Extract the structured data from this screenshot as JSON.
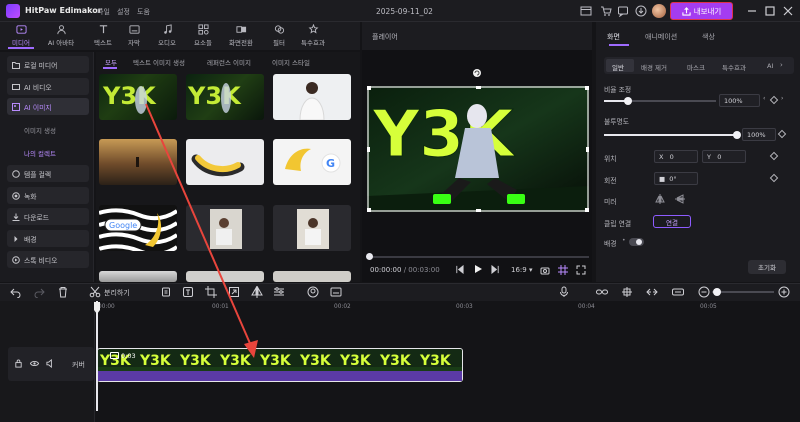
{
  "titlebar": {
    "app_name": "HitPaw Edimakor",
    "menus": [
      "파일",
      "설정",
      "도움"
    ],
    "project_title": "2025-09-11_02",
    "export_label": "내보내기"
  },
  "media_tabs": [
    {
      "label": "미디어",
      "icon": "media-icon"
    },
    {
      "label": "AI 아바타",
      "icon": "ai-avatar-icon"
    },
    {
      "label": "텍스트",
      "icon": "text-icon"
    },
    {
      "label": "자막",
      "icon": "subtitle-icon"
    },
    {
      "label": "오디오",
      "icon": "audio-icon"
    },
    {
      "label": "요소들",
      "icon": "elements-icon"
    },
    {
      "label": "화면전환",
      "icon": "transition-icon"
    },
    {
      "label": "필터",
      "icon": "filter-icon"
    },
    {
      "label": "특수효과",
      "icon": "effects-icon"
    }
  ],
  "left_nav": {
    "items": [
      "로컬 미디어",
      "AI 비디오",
      "AI 이미지",
      "템플 컬렉",
      "녹화",
      "다운로드",
      "배경",
      "스톡 비디오"
    ],
    "sub_items": [
      "이미지 생성",
      "나의 컬렉트"
    ]
  },
  "filter_tabs": [
    "모두",
    "텍스트 이미지 생성",
    "레퍼런스 이미지",
    "이미지 스타일"
  ],
  "thumbs": [
    {
      "text": "Y3K"
    },
    {
      "text": "Y3K"
    },
    {
      "text": ""
    },
    {
      "text": ""
    },
    {
      "text": ""
    },
    {
      "text": "G"
    },
    {
      "text": "Google"
    },
    {
      "text": ""
    },
    {
      "text": ""
    }
  ],
  "player": {
    "title": "플레이어",
    "video_text": "Y3K",
    "current_time": "00:00:00",
    "total_time": "/ 00:03:00",
    "aspect": "16:9"
  },
  "props": {
    "tabs": [
      "화면",
      "애니메이션",
      "색상"
    ],
    "subtabs": [
      "일반",
      "배경 제거",
      "마스크",
      "특수효과",
      "AI"
    ],
    "scale_label": "비율 조정",
    "scale_value": "100%",
    "opacity_label": "불투명도",
    "opacity_value": "100%",
    "position_label": "위치",
    "x_label": "X",
    "x_value": "0",
    "y_label": "Y",
    "y_value": "0",
    "rotate_label": "회전",
    "rotate_value": "0°",
    "flip_label": "미러",
    "link_label": "클립 연결",
    "link_button": "연결",
    "bg_label": "배경",
    "reset_label": "초기화"
  },
  "timeline": {
    "split_label": "분리하기",
    "ruler": [
      "00:00",
      "00:01",
      "00:02",
      "00:03",
      "00:04",
      "00:05"
    ],
    "track_label": "커버",
    "clip_duration": "0:03",
    "clip_text": "Y3K"
  },
  "colors": {
    "accent": "#9f6bff",
    "export_bg": "#a43cf0",
    "export_border": "#e0314b",
    "arrow": "#e8453c"
  }
}
